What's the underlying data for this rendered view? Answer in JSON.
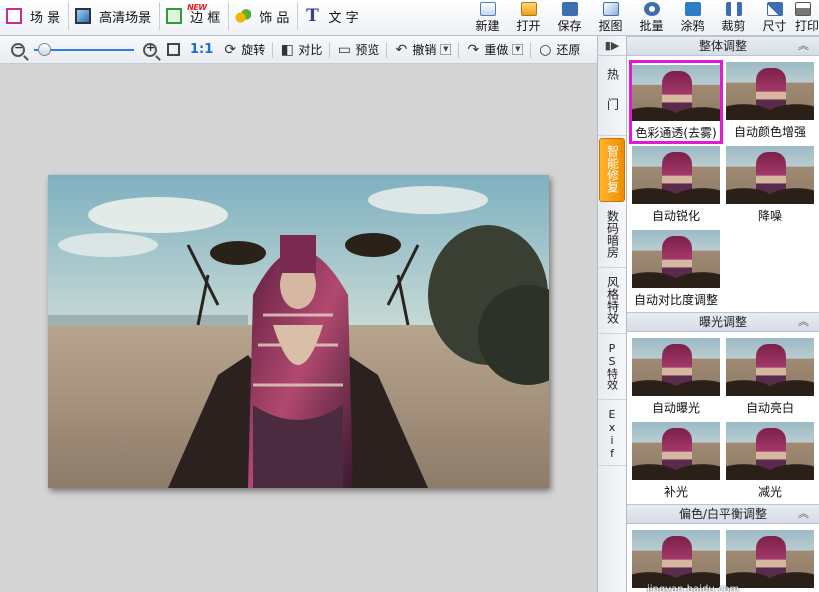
{
  "topbar": {
    "menu": [
      {
        "label": "场 景",
        "icon": "scene-icon"
      },
      {
        "label": "高清场景",
        "icon": "hd-scene-icon"
      },
      {
        "label": "边 框",
        "icon": "frame-icon"
      },
      {
        "label": "饰 品",
        "icon": "decoration-icon"
      },
      {
        "label": "文 字",
        "icon": "text-icon"
      }
    ],
    "new_badge": "NEW",
    "tools": [
      {
        "label": "新建",
        "icon": "new-file-icon"
      },
      {
        "label": "打开",
        "icon": "open-folder-icon"
      },
      {
        "label": "保存",
        "icon": "save-icon"
      },
      {
        "label": "抠图",
        "icon": "cutout-icon"
      },
      {
        "label": "批量",
        "icon": "batch-icon"
      },
      {
        "label": "涂鸦",
        "icon": "paint-icon"
      },
      {
        "label": "裁剪",
        "icon": "crop-icon"
      },
      {
        "label": "尺寸",
        "icon": "resize-icon"
      },
      {
        "label": "打印",
        "icon": "print-icon"
      }
    ]
  },
  "toolbar": {
    "zoom_label": "1:1",
    "rotate": "旋转",
    "compare": "对比",
    "preview": "预览",
    "undo": "撤销",
    "redo": "重做",
    "restore": "还原"
  },
  "vtabs": [
    {
      "label": "热门",
      "active": false
    },
    {
      "label": "智能修复",
      "active": true
    },
    {
      "label": "数码暗房",
      "active": false
    },
    {
      "label": "风格特效",
      "active": false
    },
    {
      "label": "PS特效",
      "active": false
    },
    {
      "label": "Exif",
      "active": false
    }
  ],
  "panel": {
    "sections": [
      {
        "title": "整体调整",
        "items": [
          {
            "label": "色彩通透(去雾)",
            "selected": true
          },
          {
            "label": "自动颜色增强",
            "selected": false
          },
          {
            "label": "自动锐化",
            "selected": false
          },
          {
            "label": "降噪",
            "selected": false
          },
          {
            "label": "自动对比度调整",
            "selected": false
          }
        ]
      },
      {
        "title": "曝光调整",
        "items": [
          {
            "label": "自动曝光",
            "selected": false
          },
          {
            "label": "自动亮白",
            "selected": false
          },
          {
            "label": "补光",
            "selected": false
          },
          {
            "label": "减光",
            "selected": false
          }
        ]
      },
      {
        "title": "偏色/白平衡调整",
        "items": [
          {
            "label": "",
            "selected": false
          },
          {
            "label": "",
            "selected": false
          }
        ]
      }
    ]
  },
  "watermark": "jingyan.baidu.com",
  "colors": {
    "accent": "#ee8d00",
    "selection": "#e21ad7",
    "slider": "#2a7de1"
  }
}
